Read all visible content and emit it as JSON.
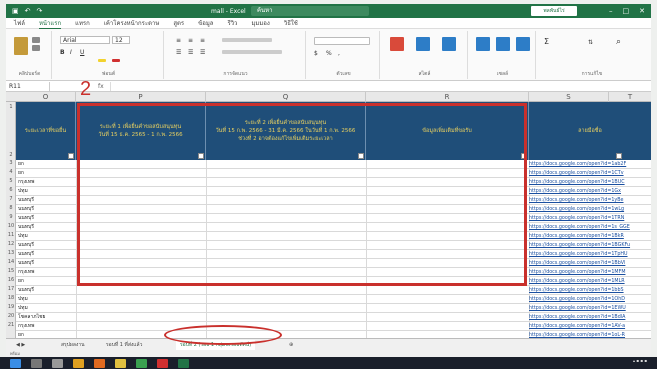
{
  "window": {
    "title": "mall - Excel",
    "search": "ค้นหา",
    "account": "พลพันธ์ไร่"
  },
  "ribbon_tabs": [
    "ไฟล์",
    "หน้าแรก",
    "แทรก",
    "เค้าโครงหน้ากระดาษ",
    "สูตร",
    "ข้อมูล",
    "รีวิว",
    "มุมมอง",
    "วิธีใช้"
  ],
  "ribbon_groups": [
    "คลิปบอร์ด",
    "ฟอนต์",
    "การจัดแนว",
    "ตัวเลข",
    "สไตล์",
    "เซลล์",
    "การแก้ไข"
  ],
  "font_name": "Arial",
  "font_size": "12",
  "cell_ref": "R11",
  "fx": "fx",
  "col_letters": [
    "O",
    "P",
    "Q",
    "R",
    "S",
    "T"
  ],
  "row_numbers": [
    "1",
    "2",
    "3",
    "4",
    "5",
    "6",
    "7",
    "8",
    "9",
    "10",
    "11",
    "12",
    "13",
    "14",
    "15",
    "16",
    "17",
    "18",
    "19",
    "20",
    "21"
  ],
  "headers": [
    "ระยะเวลาที่ขอยื่น",
    "ระยะที่ 1 เพื่อยื่นคำขอสนับสนุนทุน\nวันที่ 15 ธ.ค. 2565 - 1 ก.พ. 2566",
    "ระยะที่ 2 เพื่อยื่นคำขอสนับสนุนทุน\nวันที่ 15 ก.พ. 2566 - 31 มี.ค. 2566 ในวันที่ 1 ก.พ. 2566\nช่วงที่ 2 อาจต้องแก้ไขเพิ่มเติมระยะเวลา",
    "ข้อมูลเพิ่มเติมที่ขอรับ",
    "ลายมือชื่อ"
  ],
  "rows": [
    {
      "c1": "ยก",
      "link": "https://docs.google.com/open?id=1ab2F"
    },
    {
      "c1": "ยก",
      "link": "https://docs.google.com/open?id=1CTv"
    },
    {
      "c1": "กรุงเทพ",
      "link": "https://docs.google.com/open?id=1BUC"
    },
    {
      "c1": "ปทุม",
      "link": "https://docs.google.com/open?id=1Gx"
    },
    {
      "c1": "นนทบุรี",
      "link": "https://docs.google.com/open?id=1yBe"
    },
    {
      "c1": "นนทบุรี",
      "link": "https://docs.google.com/open?id=1wLg"
    },
    {
      "c1": "นนทบุรี",
      "link": "https://docs.google.com/open?id=1TRN"
    },
    {
      "c1": "นนทบุรี",
      "link": "https://docs.google.com/open?id=1s_GGE"
    },
    {
      "c1": "ปทุม",
      "link": "https://docs.google.com/open?id=1BkR"
    },
    {
      "c1": "นนทบุรี",
      "link": "https://docs.google.com/open?id=1BGKFu"
    },
    {
      "c1": "นนทบุรี",
      "link": "https://docs.google.com/open?id=1TpHU"
    },
    {
      "c1": "นนทบุรี",
      "link": "https://docs.google.com/open?id=1BbVl"
    },
    {
      "c1": "กรุงเทพ",
      "link": "https://docs.google.com/open?id=1MFM"
    },
    {
      "c1": "ยก",
      "link": "https://docs.google.com/open?id=1MLR"
    },
    {
      "c1": "นนทบุรี",
      "link": "https://docs.google.com/open?id=1bbS"
    },
    {
      "c1": "ปทุม",
      "link": "https://docs.google.com/open?id=1OhD"
    },
    {
      "c1": "ปทุม",
      "link": "https://docs.google.com/open?id=1EWU"
    },
    {
      "c1": "โชคลาภไชย",
      "link": "https://docs.google.com/open?id=1BdlA"
    },
    {
      "c1": "กรุงเทพ",
      "link": "https://docs.google.com/open?id=1AV-a"
    },
    {
      "c1": "ยก",
      "link": "https://docs.google.com/open?id=1oL-R"
    }
  ],
  "annotation_number": "2",
  "sheet_tabs": [
    "สรุปผลงาน",
    "รอบที่ 1 ที่ส่งแล้ว",
    "รอบที่ 2 (รอบ 1 กลุ่มจงรอบทัศน์)"
  ],
  "status": "พร้อม"
}
